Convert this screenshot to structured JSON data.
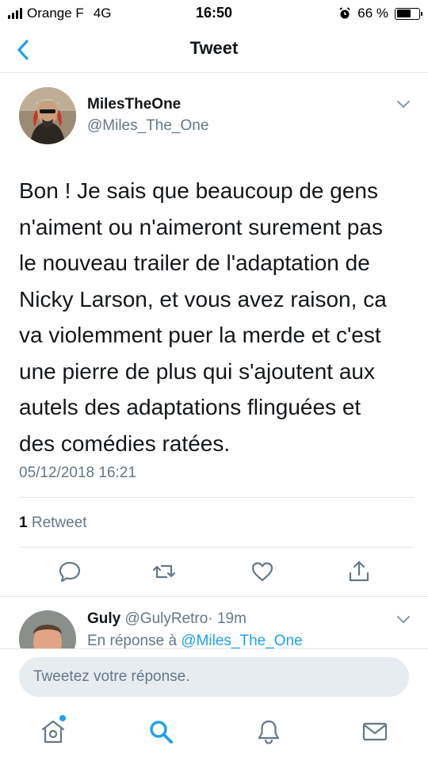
{
  "status_bar": {
    "carrier": "Orange F",
    "network": "4G",
    "time": "16:50",
    "battery_percent": "66 %",
    "battery_level": 0.66,
    "icons": [
      "signal-icon",
      "alarm-icon",
      "battery-icon"
    ]
  },
  "header": {
    "title": "Tweet",
    "back_icon": "chevron-left-icon"
  },
  "tweet": {
    "author_name": "MilesTheOne",
    "author_handle": "@Miles_The_One",
    "text": "Bon ! Je sais que beaucoup de gens\nn'aiment ou n'aimeront surement pas\nle nouveau trailer de l'adaptation de\nNicky Larson, et vous avez raison, ca\nva violemment puer la merde et c'est\nune pierre de plus qui s'ajoutent aux\nautels des adaptations flinguées et\ndes comédies ratées.",
    "timestamp": "05/12/2018 16:21",
    "retweet_count": "1",
    "retweet_label": "Retweet",
    "actions": [
      "reply-icon",
      "retweet-icon",
      "like-icon",
      "share-icon"
    ]
  },
  "reply": {
    "name": "Guly",
    "handle": "@GulyRetro",
    "time": "· 19m",
    "in_reply_prefix": "En réponse à ",
    "in_reply_to": "@Miles_The_One"
  },
  "compose": {
    "placeholder": "Tweetez votre réponse."
  },
  "tabbar": {
    "tabs": [
      "home-icon",
      "search-icon",
      "notifications-icon",
      "messages-icon"
    ],
    "active": "search-icon"
  },
  "colors": {
    "accent": "#1da1f2",
    "text": "#14171a",
    "secondary": "#657786",
    "divider": "#e1e8ed"
  }
}
